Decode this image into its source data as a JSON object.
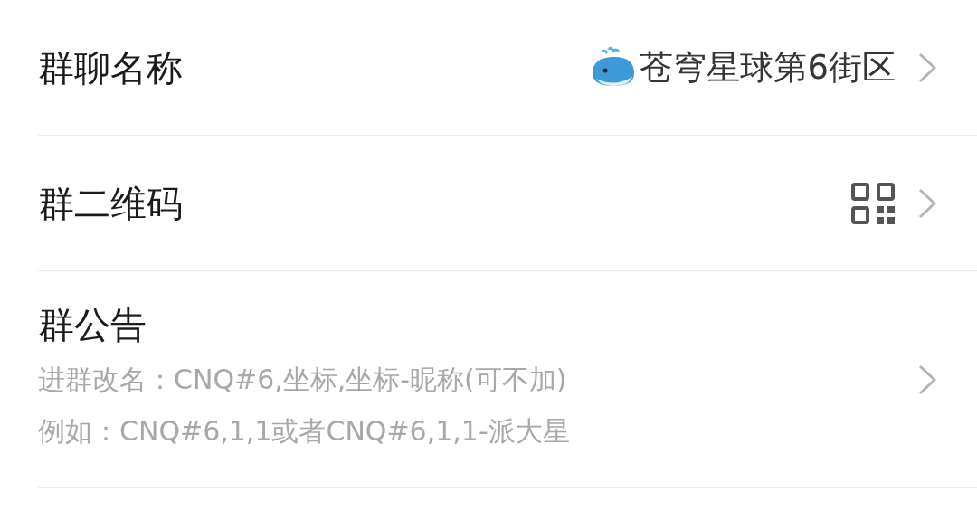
{
  "rows": [
    {
      "kind": "value",
      "label": "群聊名称",
      "value": "苍穹星球第6街区"
    },
    {
      "kind": "qr",
      "label": "群二维码"
    },
    {
      "kind": "notice",
      "label": "群公告",
      "lines": [
        "进群改名：CNQ#6,坐标,坐标-昵称(可不加)",
        "例如：CNQ#6,1,1或者CNQ#6,1,1-派大星"
      ]
    }
  ]
}
